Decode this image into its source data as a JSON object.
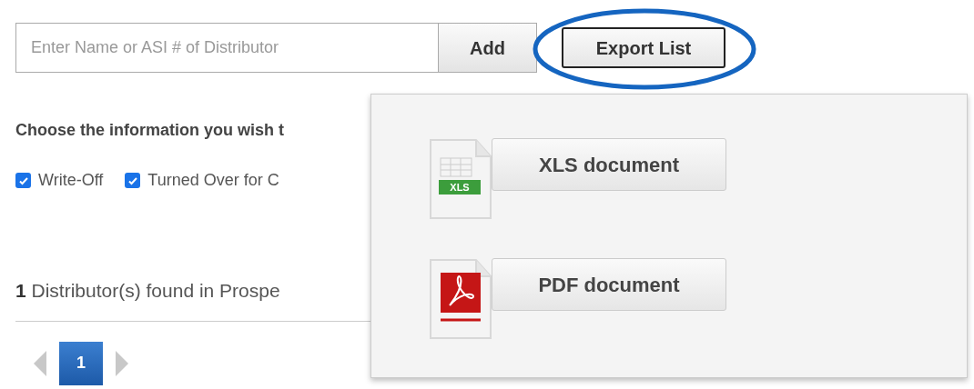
{
  "search": {
    "placeholder": "Enter Name or ASI # of Distributor"
  },
  "add_button": "Add",
  "export_button": "Export List",
  "export_menu": {
    "items": [
      {
        "kind": "xls",
        "label": "XLS document",
        "icon_label": "XLS"
      },
      {
        "kind": "pdf",
        "label": "PDF document"
      }
    ]
  },
  "info_heading": "Choose the information you wish t",
  "options": [
    {
      "label": "Write-Off",
      "checked": true
    },
    {
      "label": "Turned Over for C",
      "checked": true
    }
  ],
  "result": {
    "count": "1",
    "text": " Distributor(s) found in Prospe"
  },
  "pagination": {
    "pages": [
      {
        "label": "1",
        "selected": true
      }
    ]
  }
}
